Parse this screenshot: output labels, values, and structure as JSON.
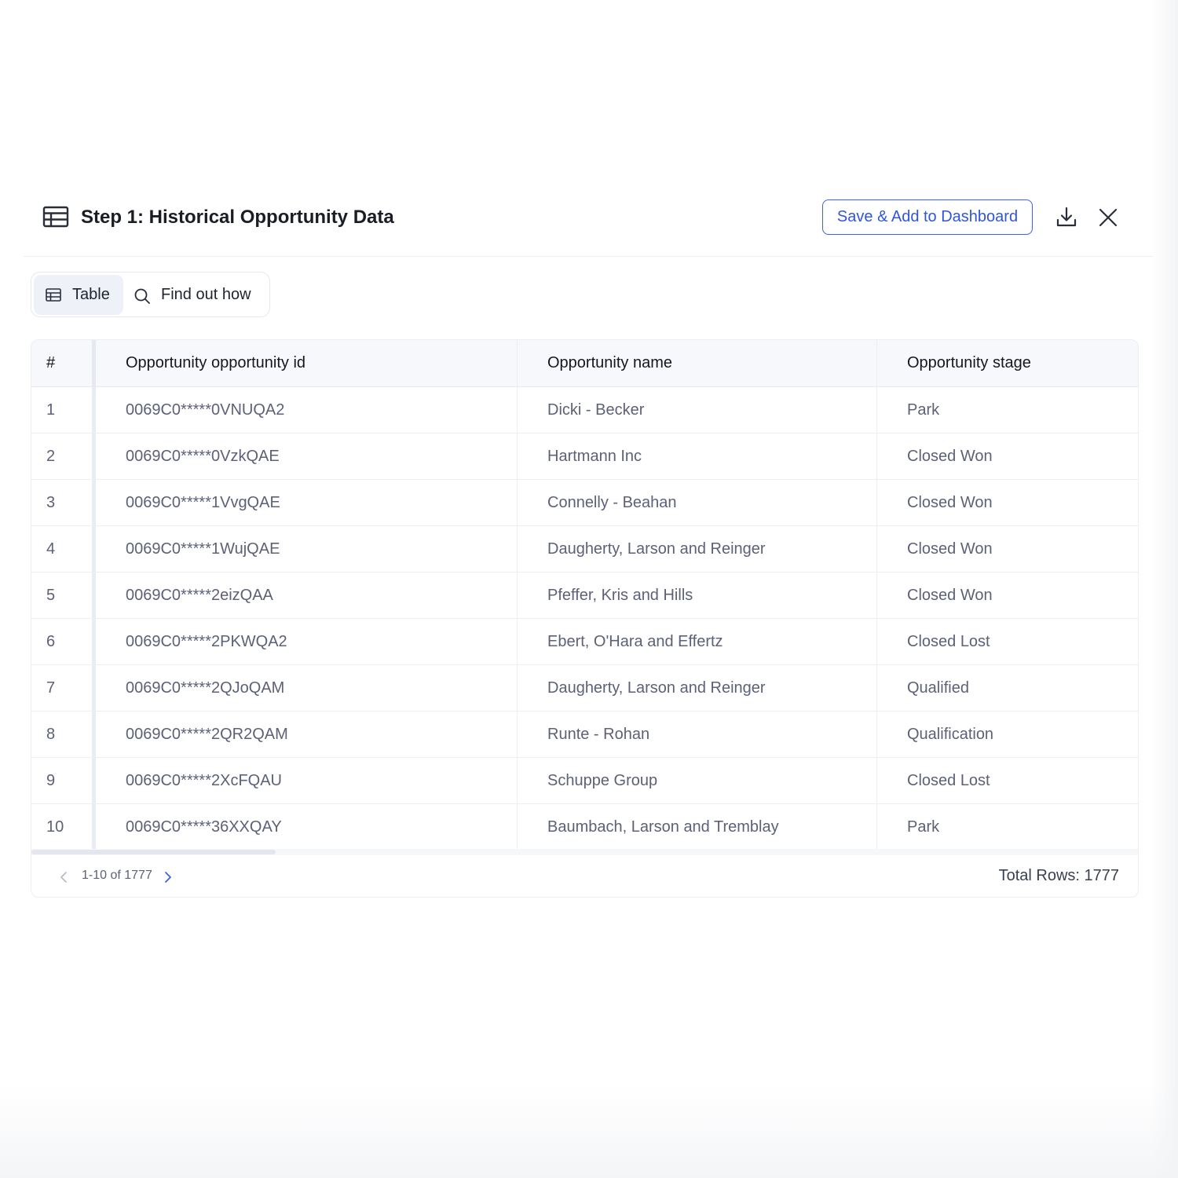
{
  "header": {
    "title": "Step 1: Historical Opportunity Data",
    "title_icon": "table-icon",
    "save_label": "Save & Add to Dashboard",
    "download_icon": "download-icon",
    "close_icon": "close-icon"
  },
  "tabs": [
    {
      "label": "Table",
      "icon": "table-icon",
      "active": true
    },
    {
      "label": "Find out how",
      "icon": "search-icon",
      "active": false
    }
  ],
  "table": {
    "columns": [
      "#",
      "Opportunity opportunity id",
      "Opportunity name",
      "Opportunity stage"
    ],
    "rows": [
      {
        "num": "1",
        "id": "0069C0*****0VNUQA2",
        "name": "Dicki - Becker",
        "stage": "Park"
      },
      {
        "num": "2",
        "id": "0069C0*****0VzkQAE",
        "name": "Hartmann Inc",
        "stage": "Closed Won"
      },
      {
        "num": "3",
        "id": "0069C0*****1VvgQAE",
        "name": "Connelly - Beahan",
        "stage": "Closed Won"
      },
      {
        "num": "4",
        "id": "0069C0*****1WujQAE",
        "name": "Daugherty, Larson and Reinger",
        "stage": "Closed Won"
      },
      {
        "num": "5",
        "id": "0069C0*****2eizQAA",
        "name": "Pfeffer, Kris and Hills",
        "stage": "Closed Won"
      },
      {
        "num": "6",
        "id": "0069C0*****2PKWQA2",
        "name": "Ebert, O'Hara and Effertz",
        "stage": "Closed Lost"
      },
      {
        "num": "7",
        "id": "0069C0*****2QJoQAM",
        "name": "Daugherty, Larson and Reinger",
        "stage": "Qualified"
      },
      {
        "num": "8",
        "id": "0069C0*****2QR2QAM",
        "name": "Runte - Rohan",
        "stage": "Qualification"
      },
      {
        "num": "9",
        "id": "0069C0*****2XcFQAU",
        "name": "Schuppe Group",
        "stage": "Closed Lost"
      },
      {
        "num": "10",
        "id": "0069C0*****36XXQAY",
        "name": "Baumbach, Larson and Tremblay",
        "stage": "Park"
      }
    ]
  },
  "pagination": {
    "range_text": "1-10 of 1777",
    "total_rows_text": "Total Rows: 1777"
  },
  "colors": {
    "accent": "#3d63e0",
    "text_primary": "#1a1d26",
    "text_secondary": "#5c6178",
    "header_bg": "#f7f8fb"
  }
}
